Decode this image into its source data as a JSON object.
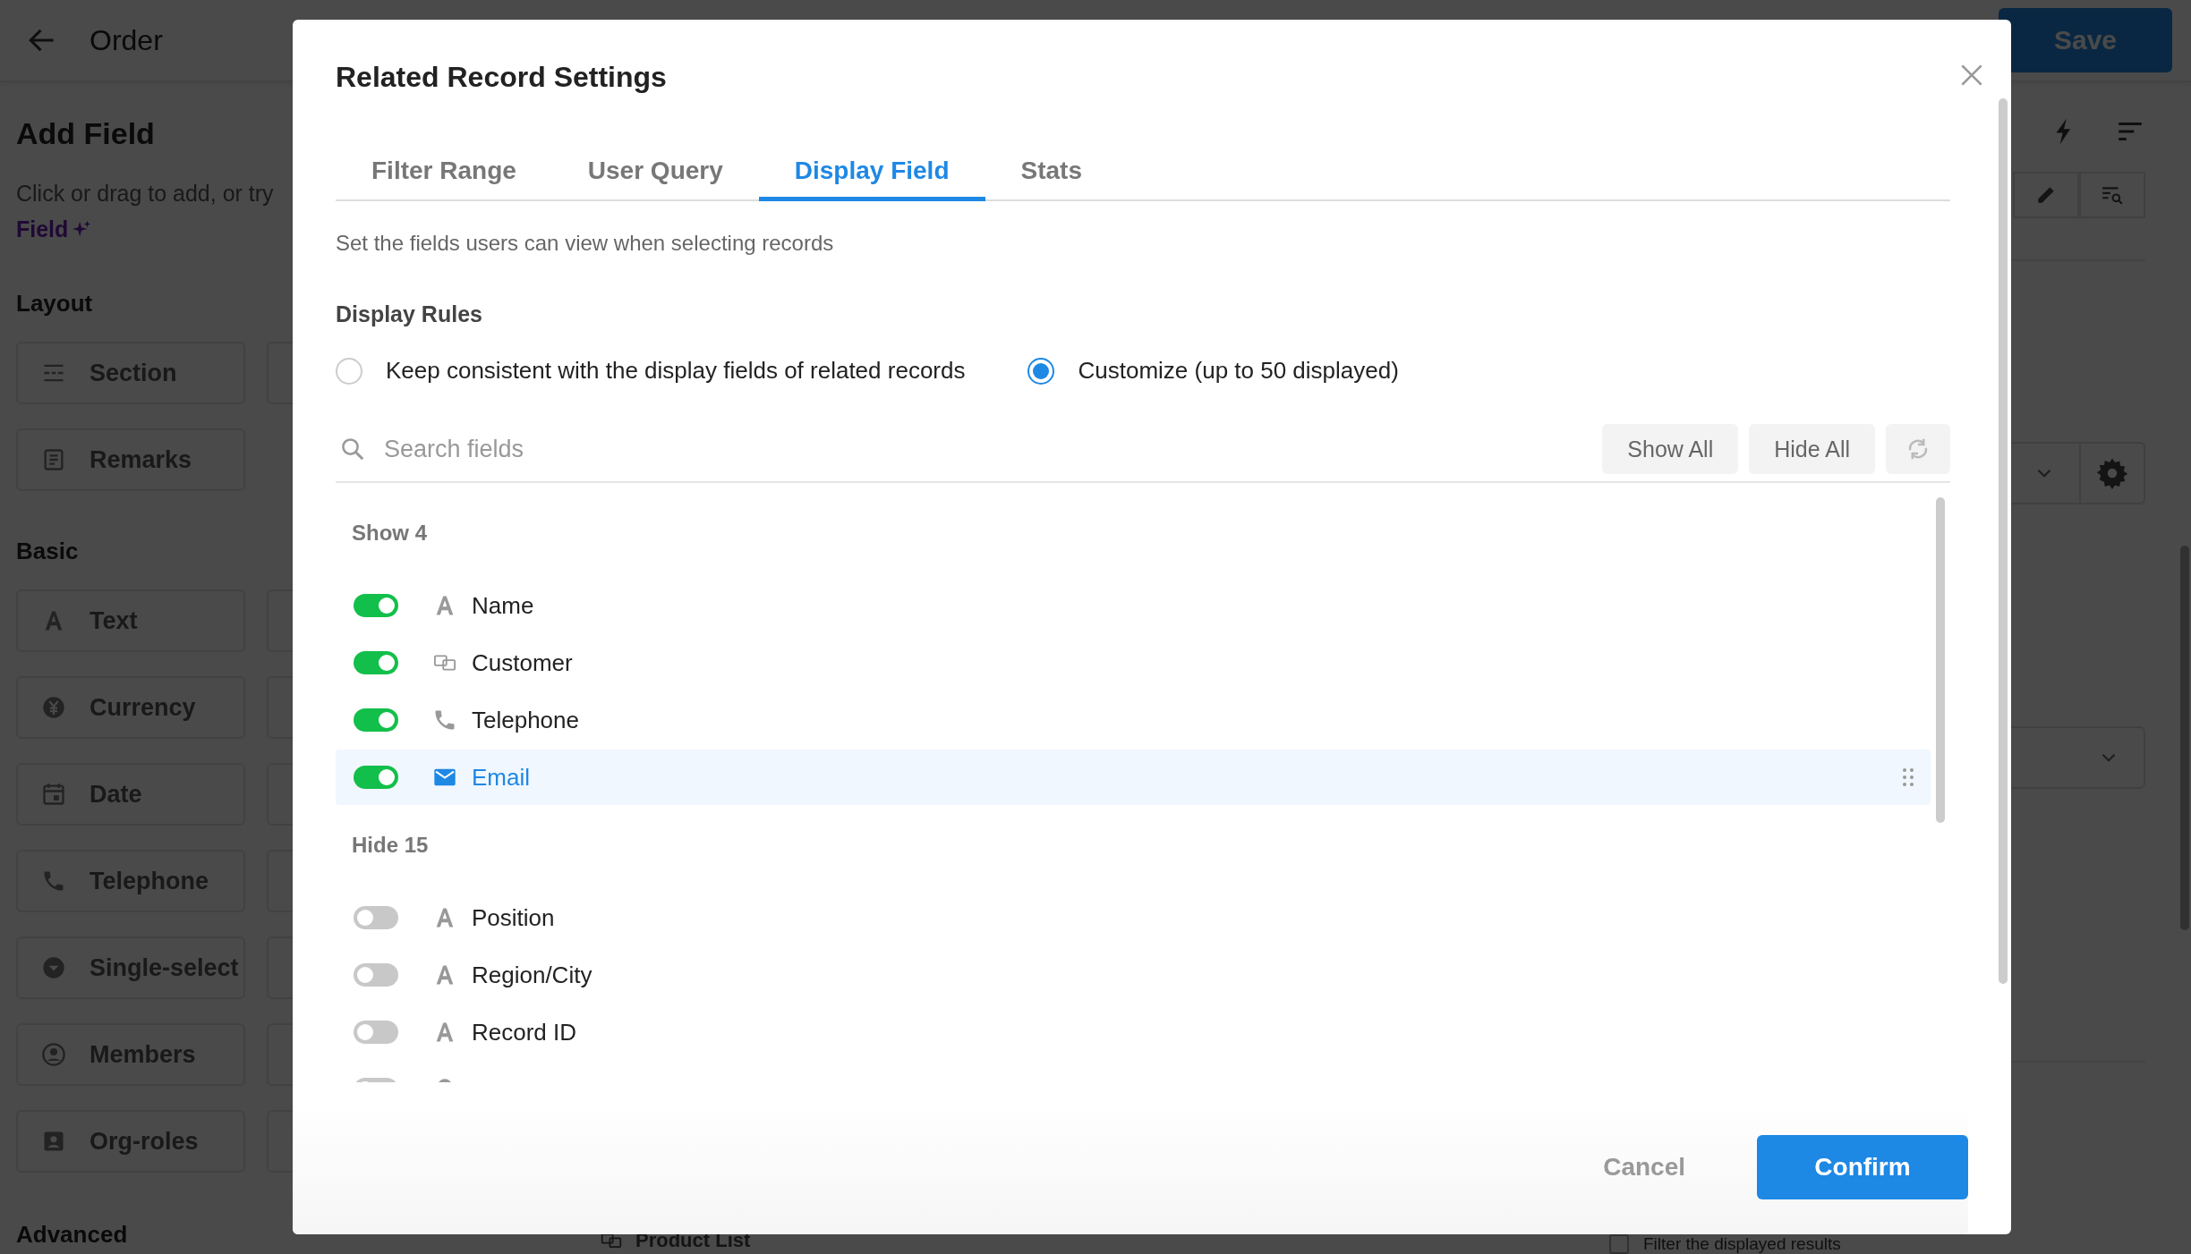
{
  "header": {
    "title": "Order",
    "save_button": "Save"
  },
  "add_field": {
    "title": "Add Field",
    "hint": "Click or drag to add, or try",
    "ai_link": "Field",
    "groups": [
      {
        "title": "Layout",
        "items": [
          {
            "kind": "section",
            "label": "Section"
          },
          {
            "kind": "cut"
          },
          {
            "kind": "remarks",
            "label": "Remarks"
          }
        ]
      },
      {
        "title": "Basic",
        "items": [
          {
            "kind": "text",
            "label": "Text"
          },
          {
            "kind": "cut"
          },
          {
            "kind": "currency",
            "label": "Currency"
          },
          {
            "kind": "cut"
          },
          {
            "kind": "date",
            "label": "Date"
          },
          {
            "kind": "cut"
          },
          {
            "kind": "phone",
            "label": "Telephone"
          },
          {
            "kind": "cut"
          },
          {
            "kind": "select",
            "label": "Single-select"
          },
          {
            "kind": "cut"
          },
          {
            "kind": "member",
            "label": "Members"
          },
          {
            "kind": "cut"
          },
          {
            "kind": "badge",
            "label": "Org-roles"
          },
          {
            "kind": "cut"
          }
        ]
      }
    ],
    "advanced_title": "Advanced"
  },
  "canvas": {
    "product_list": "Product List"
  },
  "properties": {
    "filter_option": {
      "label": "Filter the displayed results",
      "checked": false
    }
  },
  "dialog": {
    "title": "Related Record Settings",
    "tabs": [
      {
        "label": "Filter Range",
        "selected": false
      },
      {
        "label": "User Query",
        "selected": false
      },
      {
        "label": "Display Field",
        "selected": true
      },
      {
        "label": "Stats",
        "selected": false
      }
    ],
    "description": "Set the fields users can view when selecting records",
    "rules_title": "Display Rules",
    "rules": [
      {
        "label": "Keep consistent with the display fields of related records",
        "selected": false
      },
      {
        "label": "Customize (up to 50 displayed)",
        "selected": true
      }
    ],
    "search": {
      "placeholder": "Search fields"
    },
    "actions": [
      "Show All",
      "Hide All"
    ],
    "groups": [
      {
        "title": "Show 4",
        "fields": [
          {
            "label": "Name",
            "kind": "text",
            "on": true,
            "selected": false
          },
          {
            "label": "Customer",
            "kind": "link",
            "on": true,
            "selected": false
          },
          {
            "label": "Telephone",
            "kind": "phone",
            "on": true,
            "selected": false
          },
          {
            "label": "Email",
            "kind": "mail",
            "on": true,
            "selected": true
          }
        ]
      },
      {
        "title": "Hide 15",
        "fields": [
          {
            "label": "Position",
            "kind": "text",
            "on": false,
            "selected": false
          },
          {
            "label": "Region/City",
            "kind": "text",
            "on": false,
            "selected": false
          },
          {
            "label": "Record ID",
            "kind": "text",
            "on": false,
            "selected": false
          },
          {
            "kind": "pin",
            "on": false,
            "selected": false
          }
        ]
      }
    ],
    "buttons": {
      "cancel": "Cancel",
      "confirm": "Confirm"
    }
  }
}
